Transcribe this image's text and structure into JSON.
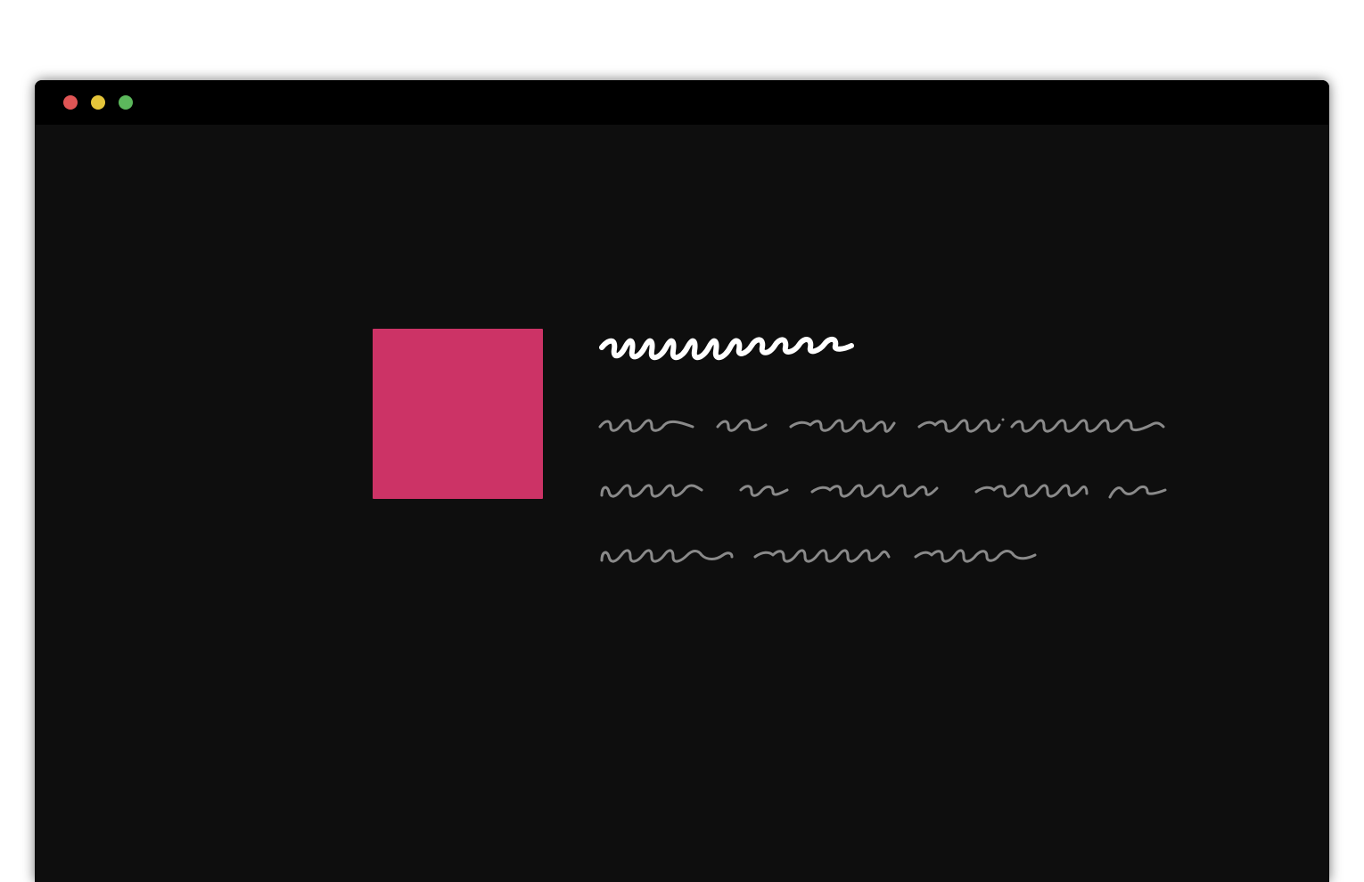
{
  "window": {
    "controls": [
      {
        "name": "close",
        "color": "#e05555"
      },
      {
        "name": "minimize",
        "color": "#e5c53a"
      },
      {
        "name": "zoom",
        "color": "#5cb85c"
      }
    ]
  },
  "content": {
    "thumbnail_color": "#cc3366",
    "title_color": "#ffffff",
    "body_color": "#8a8a8a"
  }
}
